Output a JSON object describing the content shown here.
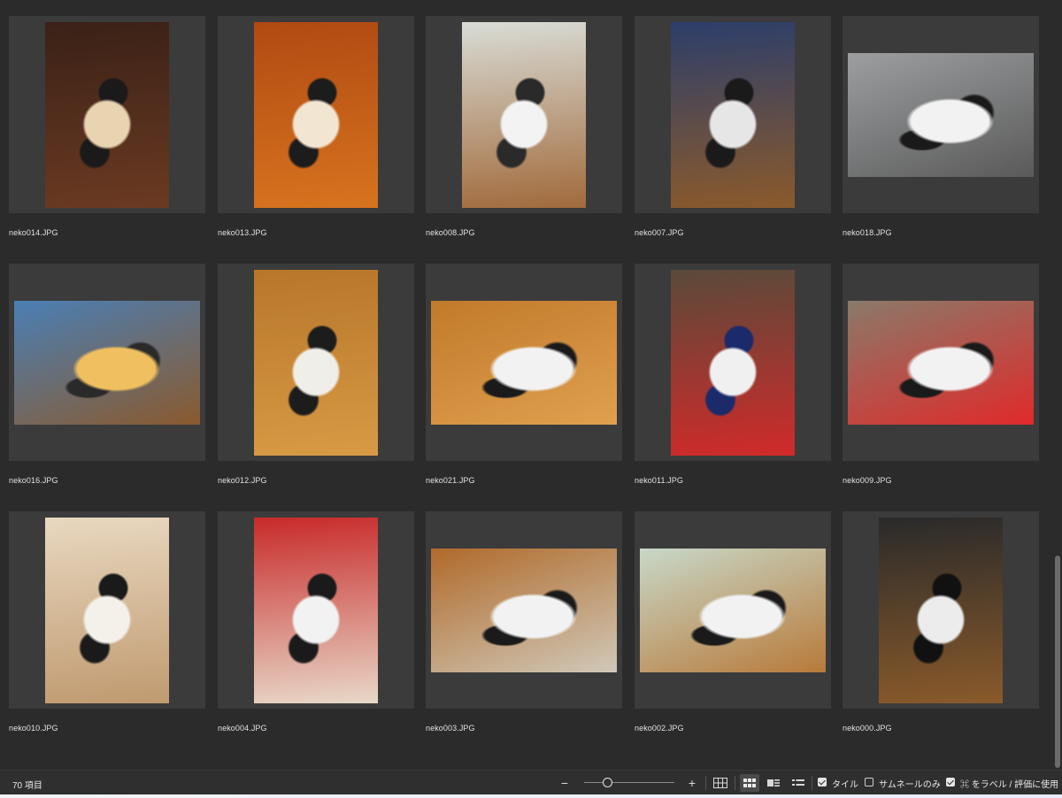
{
  "grid": {
    "items": [
      {
        "filename": "neko014.JPG",
        "orientation": "portrait",
        "palette": [
          "#3a2117",
          "#6b3a22",
          "#e8d4b0",
          "#1a1a1a"
        ]
      },
      {
        "filename": "neko013.JPG",
        "orientation": "portrait",
        "palette": [
          "#b04a12",
          "#d8731f",
          "#f2e6d2",
          "#1c1c1c"
        ]
      },
      {
        "filename": "neko008.JPG",
        "orientation": "portrait",
        "palette": [
          "#d9dcd6",
          "#a16a3b",
          "#f3f3f3",
          "#2a2a2a"
        ]
      },
      {
        "filename": "neko007.JPG",
        "orientation": "portrait",
        "palette": [
          "#2c3e6a",
          "#8b5a2b",
          "#e6e6e6",
          "#1a1a1a"
        ]
      },
      {
        "filename": "neko018.JPG",
        "orientation": "landscape",
        "palette": [
          "#9c9ea0",
          "#5a5a5a",
          "#f2f2f2",
          "#1a1a1a"
        ]
      },
      {
        "filename": "neko016.JPG",
        "orientation": "landscape",
        "palette": [
          "#4a7fb5",
          "#8a5a2e",
          "#f0c060",
          "#2a2a2a"
        ]
      },
      {
        "filename": "neko012.JPG",
        "orientation": "portrait",
        "palette": [
          "#b8762a",
          "#d89a45",
          "#f0eee8",
          "#1c1c1c"
        ]
      },
      {
        "filename": "neko021.JPG",
        "orientation": "landscape",
        "palette": [
          "#c07a2a",
          "#e0a050",
          "#f2f2f2",
          "#1a1a1a"
        ]
      },
      {
        "filename": "neko011.JPG",
        "orientation": "portrait",
        "palette": [
          "#5a4a3a",
          "#d02a2a",
          "#f0f0f0",
          "#1a2a6a"
        ]
      },
      {
        "filename": "neko009.JPG",
        "orientation": "landscape",
        "palette": [
          "#8a7a6a",
          "#e02a2a",
          "#f2f2f2",
          "#1a1a1a"
        ]
      },
      {
        "filename": "neko010.JPG",
        "orientation": "portrait",
        "palette": [
          "#e8d8c0",
          "#c09a70",
          "#f4f0ea",
          "#1a1a1a"
        ]
      },
      {
        "filename": "neko004.JPG",
        "orientation": "portrait",
        "palette": [
          "#c82a2a",
          "#e8d8c8",
          "#f2f2f2",
          "#1a1a1a"
        ]
      },
      {
        "filename": "neko003.JPG",
        "orientation": "landscape",
        "palette": [
          "#b06a2a",
          "#d0c8b8",
          "#f2f2f2",
          "#1a1a1a"
        ]
      },
      {
        "filename": "neko002.JPG",
        "orientation": "landscape",
        "palette": [
          "#c8d8c8",
          "#b87a3a",
          "#f2f2f2",
          "#1a1a1a"
        ]
      },
      {
        "filename": "neko000.JPG",
        "orientation": "portrait",
        "palette": [
          "#2a2a2a",
          "#8a5a2a",
          "#ececec",
          "#111111"
        ]
      }
    ]
  },
  "status": {
    "count": "70 項目"
  },
  "toolbar": {
    "zoom_out": "−",
    "zoom_in": "+",
    "zoom_level_fraction": 0.25,
    "tile_label": "タイル",
    "tile_checked": true,
    "thumb_only_label": "サムネールのみ",
    "thumb_only_checked": false,
    "cmd_label": "⌘ をラベル / 評価に使用",
    "cmd_checked": true,
    "active_view": "tile"
  },
  "icons": {
    "grid": "grid-icon",
    "tile": "tile-view-icon",
    "wide": "wide-view-icon",
    "list": "list-view-icon"
  }
}
